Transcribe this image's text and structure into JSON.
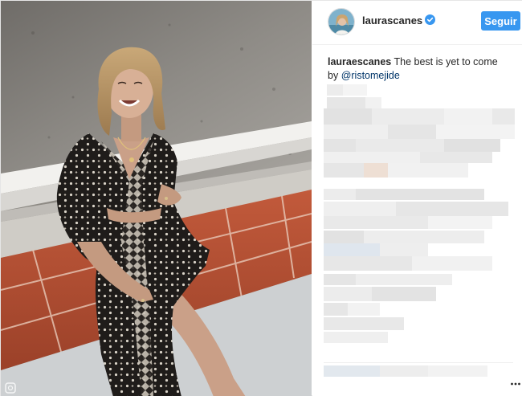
{
  "post": {
    "author": {
      "username": "laurascanes",
      "verified": true,
      "avatar_icon": "user-avatar"
    },
    "follow_label": "Seguir",
    "caption": {
      "username": "lauraescanes",
      "text": " The best is yet to come",
      "prefix": "by ",
      "mention": "@ristomejide"
    },
    "comments_blurred": true,
    "more_icon": "more-options-icon"
  },
  "colors": {
    "follow_button": "#3897f0",
    "mention": "#003569",
    "verified_badge": "#3897f0"
  }
}
